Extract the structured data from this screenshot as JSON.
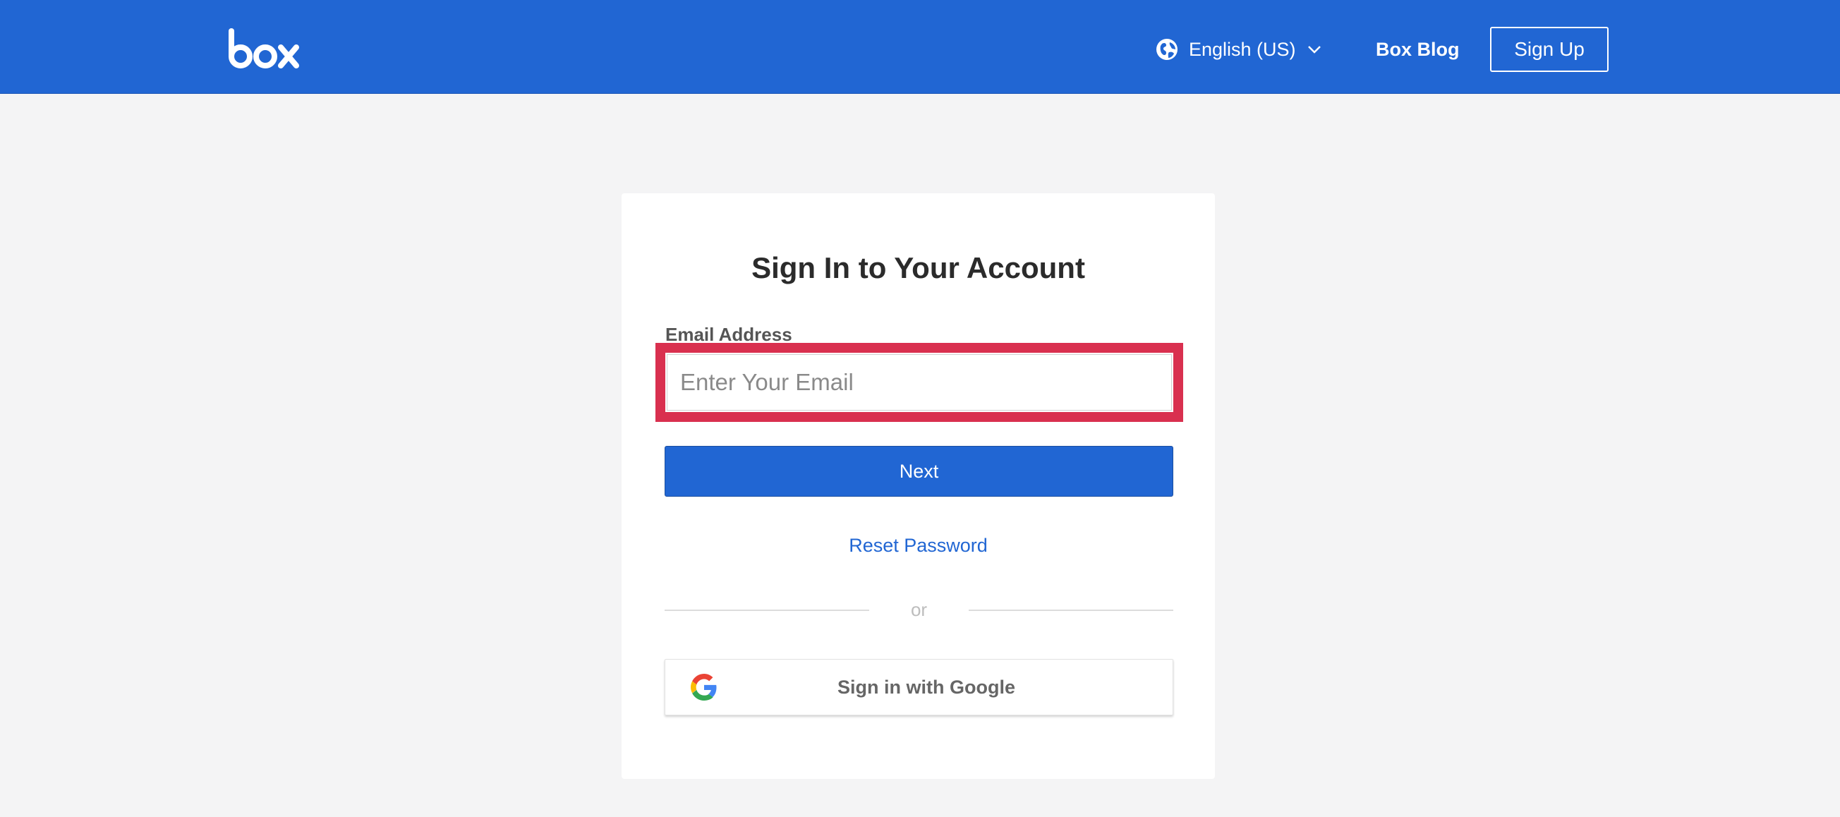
{
  "header": {
    "logo_text": "box",
    "language_label": "English (US)",
    "blog_label": "Box Blog",
    "signup_label": "Sign Up"
  },
  "login": {
    "title": "Sign In to Your Account",
    "email_label": "Email Address",
    "email_placeholder": "Enter Your Email",
    "email_value": "",
    "next_label": "Next",
    "reset_label": "Reset Password",
    "or_label": "or",
    "google_label": "Sign in with Google"
  },
  "icons": {
    "globe": "globe-icon",
    "chevron": "chevron-down-icon",
    "google": "google-icon"
  },
  "colors": {
    "brand_blue": "#2166d3",
    "highlight_red": "#d9304f",
    "page_bg": "#f4f4f5"
  }
}
